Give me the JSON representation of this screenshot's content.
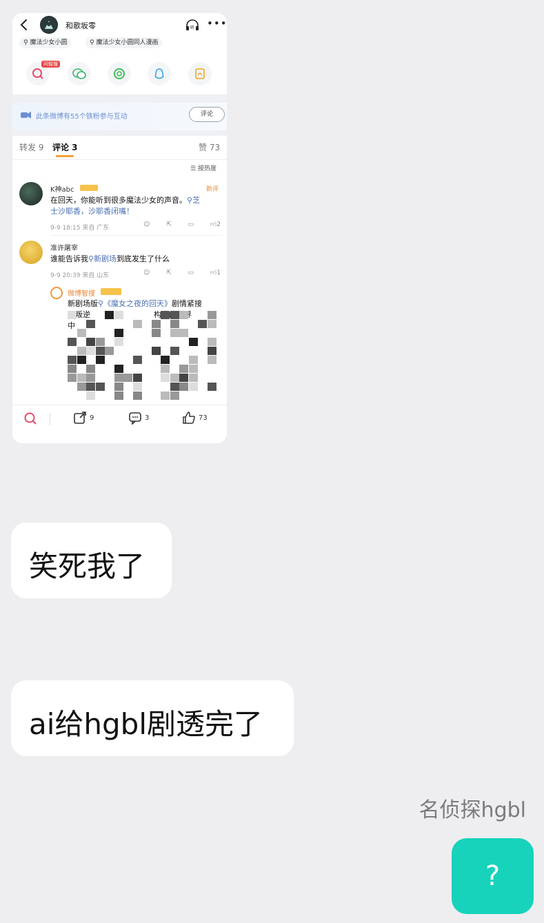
{
  "screenshot": {
    "topbar": {
      "account_name": "和歌坂零"
    },
    "search_chips": [
      "魔法少女小圆",
      "魔法少女小圆同人漫画"
    ],
    "share_badge": "问智搜",
    "fans_banner": {
      "text": "此条微博有55个铁粉参与互动",
      "button": "评论"
    },
    "tabs": {
      "repost": "转发 9",
      "comment": "评论 3",
      "like": "赞 73"
    },
    "sort_label": "按热度",
    "comments": [
      {
        "user": "K神abc",
        "tag": "新评",
        "text_a": "在回天，你能听到很多魔法少女的声音。",
        "link": "芝",
        "text_b": "士沙耶香，沙耶香闭嘴！",
        "meta": "9-9 18:15  来自 广东",
        "likes": "2"
      },
      {
        "user": "准许屠宰",
        "text_a": "谁能告诉我",
        "link": "新剧场",
        "text_b": "到底发生了什么",
        "meta": "9-9 20:39  来自 山东",
        "likes": "1"
      }
    ],
    "reply": {
      "user": "微博智搜",
      "line1_a": "新剧场版",
      "line1_link": "《魔女之夜的回天》",
      "line1_b": "剧情紧接",
      "line2_a": "《叛逆",
      "line2_b": "构建的世界",
      "line3": "中"
    },
    "bottom": {
      "reposts": "9",
      "comments": "3",
      "likes": "73"
    }
  },
  "messages": [
    {
      "text": "笑死我了"
    },
    {
      "text": "ai给hgbl剧透完了"
    }
  ],
  "self": {
    "name": "名侦探hgbl",
    "message": "?"
  },
  "colors": {
    "accent_teal": "#17d3bb",
    "chat_bg": "#eeeef1",
    "link_blue": "#4a6fb3"
  }
}
